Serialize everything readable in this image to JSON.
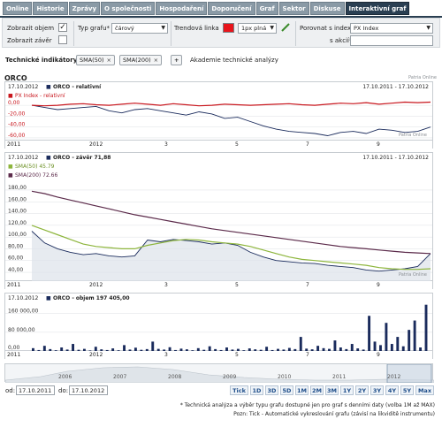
{
  "tabs": [
    "Online",
    "Historie",
    "Zprávy",
    "O společnosti",
    "Hospodaření",
    "Doporučení",
    "Graf",
    "Sektor",
    "Diskuse",
    "Interaktivní graf"
  ],
  "active_tab": "Interaktivní graf",
  "controls": {
    "volume_label": "Zobrazit objem",
    "volume_checked": true,
    "close_label": "Zobrazit závěr",
    "close_checked": false,
    "chart_type_label": "Typ grafu*",
    "chart_type_value": "čárový",
    "trend_label": "Trendová linka",
    "trend_color": "#e8141b",
    "trend_width": "1px plná",
    "compare_label": "Porovnat s indexem*",
    "compare_value": "PX Index",
    "stock_label": "s akcií*",
    "stock_value": ""
  },
  "indicators": {
    "label": "Technické indikátory*:",
    "items": [
      "SMA(50)",
      "SMA(200)"
    ],
    "add": "+",
    "academy": "Akademie technické analýzy"
  },
  "chart_title": "ORCO",
  "watermark": "Patria Online",
  "chart_data": [
    {
      "type": "line",
      "header_left": "17.10.2012",
      "series_label": "ORCO - relativní",
      "header_right": "17.10.2011 - 17.10.2012",
      "legend2": "PX Index - relativní",
      "yticks": [
        "0,00",
        "-20,00",
        "-40,00",
        "-60,00"
      ],
      "series": [
        {
          "name": "ORCO - relativní",
          "color": "#1a2b5c",
          "values": [
            0,
            -4,
            -8,
            -6,
            -4,
            -2,
            -10,
            -14,
            -8,
            -6,
            -10,
            -14,
            -18,
            -12,
            -16,
            -24,
            -22,
            -30,
            -38,
            -44,
            -48,
            -50,
            -52,
            -56,
            -50,
            -48,
            -52,
            -44,
            -46,
            -50,
            -48,
            -40
          ]
        },
        {
          "name": "PX Index - relativní",
          "color": "#c8161d",
          "values": [
            0,
            -1,
            0,
            2,
            3,
            1,
            0,
            2,
            4,
            2,
            0,
            3,
            1,
            -1,
            0,
            2,
            1,
            0,
            1,
            2,
            3,
            1,
            0,
            2,
            4,
            3,
            5,
            2,
            4,
            6,
            5,
            6
          ]
        }
      ],
      "ylim": [
        -65,
        10
      ]
    },
    {
      "type": "line",
      "header_left": "17.10.2012",
      "series_label": "ORCO - závěr 71,88",
      "header_right": "17.10.2011 - 17.10.2012",
      "legend_sma50": "SMA(50) 45.79",
      "legend_sma200": "SMA(200) 72.66",
      "yticks": [
        "180,00",
        "160,00",
        "140,00",
        "120,00",
        "100,00",
        "80,00",
        "60,00",
        "40,00"
      ],
      "series": [
        {
          "name": "ORCO - závěr",
          "color": "#1a2b5c",
          "values": [
            110,
            90,
            80,
            74,
            70,
            72,
            68,
            66,
            68,
            95,
            92,
            96,
            94,
            92,
            88,
            90,
            86,
            74,
            66,
            60,
            58,
            56,
            55,
            52,
            50,
            48,
            44,
            42,
            44,
            46,
            50,
            72
          ]
        },
        {
          "name": "SMA(50)",
          "color": "#8db53c",
          "values": [
            120,
            112,
            104,
            96,
            88,
            84,
            82,
            80,
            80,
            86,
            90,
            94,
            96,
            95,
            92,
            90,
            88,
            84,
            78,
            72,
            66,
            62,
            60,
            58,
            56,
            54,
            52,
            48,
            46,
            45,
            45,
            46
          ]
        },
        {
          "name": "SMA(200)",
          "color": "#5b2a4a",
          "values": [
            178,
            174,
            168,
            163,
            158,
            153,
            148,
            143,
            138,
            134,
            130,
            126,
            122,
            118,
            114,
            111,
            108,
            105,
            102,
            99,
            96,
            93,
            90,
            87,
            84,
            82,
            80,
            78,
            76,
            74,
            73,
            72
          ]
        }
      ],
      "ylim": [
        25,
        195
      ]
    },
    {
      "type": "bar",
      "header_left": "17.10.2012",
      "series_label": "ORCO - objem 197 405,00",
      "yticks": [
        "160 000,00",
        "80 000,00",
        "0,00"
      ],
      "values": [
        12000,
        4000,
        22000,
        8000,
        3000,
        15000,
        6000,
        30000,
        5000,
        9000,
        2000,
        18000,
        7000,
        4000,
        11000,
        3000,
        25000,
        6000,
        14000,
        5000,
        8000,
        40000,
        9000,
        6000,
        16000,
        4000,
        10000,
        7000,
        3000,
        12000,
        5000,
        20000,
        8000,
        4000,
        15000,
        6000,
        9000,
        3000,
        11000,
        7000,
        5000,
        18000,
        4000,
        9000,
        6000,
        13000,
        8000,
        60000,
        10000,
        7000,
        22000,
        12000,
        9000,
        45000,
        15000,
        8000,
        30000,
        11000,
        6000,
        150000,
        40000,
        25000,
        120000,
        30000,
        60000,
        20000,
        90000,
        130000,
        15000,
        197405
      ],
      "ylim": [
        0,
        200000
      ]
    }
  ],
  "x_axis": [
    "2011",
    "2012",
    "3",
    "5",
    "7",
    "9"
  ],
  "navigator_years": [
    "2006",
    "2007",
    "2008",
    "2009",
    "2010",
    "2011",
    "2012"
  ],
  "range": {
    "from_label": "od:",
    "from": "17.10.2011",
    "to_label": "do:",
    "to": "17.10.2012"
  },
  "zoom_buttons": [
    "Tick",
    "1D",
    "3D",
    "5D",
    "1M",
    "2M",
    "3M",
    "1Y",
    "2Y",
    "3Y",
    "4Y",
    "5Y",
    "Max"
  ],
  "notes": [
    "* Technická analýza a výběr typu grafu dostupné jen pro graf s denními daty (volba 1M až MAX)",
    "Pozn: Tick - Automatické vykreslování grafu (závisí na likviditě instrumentu)"
  ]
}
